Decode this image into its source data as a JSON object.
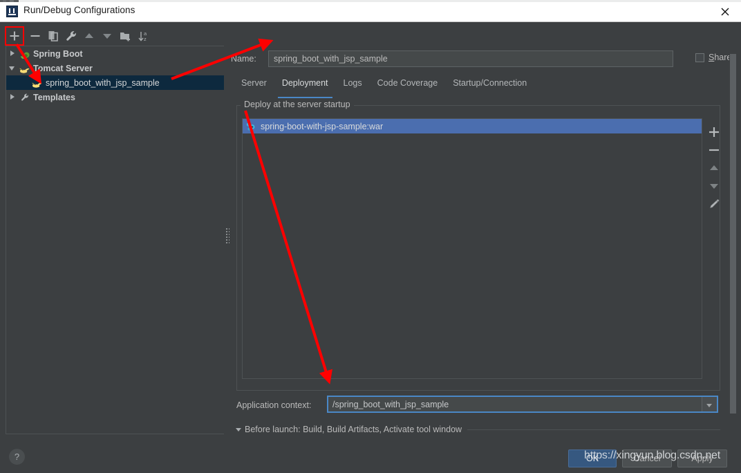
{
  "window": {
    "title": "Run/Debug Configurations",
    "app_icon": "intellij-idea-icon",
    "close_icon": "close-icon"
  },
  "left_panel": {
    "toolbar": [
      {
        "name": "add-configuration-button",
        "icon": "plus-icon",
        "label": "+",
        "highlighted": true
      },
      {
        "name": "remove-configuration-button",
        "icon": "minus-icon",
        "label": "−",
        "highlighted": false
      },
      {
        "name": "copy-configuration-button",
        "icon": "copy-icon",
        "label": "",
        "highlighted": false
      },
      {
        "name": "edit-templates-button",
        "icon": "wrench-icon",
        "label": "",
        "highlighted": false
      },
      {
        "name": "move-up-button",
        "icon": "arrow-up-icon",
        "label": "",
        "highlighted": false
      },
      {
        "name": "move-down-button",
        "icon": "arrow-down-icon",
        "label": "",
        "highlighted": false
      },
      {
        "name": "move-into-folder-button",
        "icon": "folder-add-icon",
        "label": "",
        "highlighted": false
      },
      {
        "name": "sort-configurations-button",
        "icon": "sort-az-icon",
        "label": "",
        "highlighted": false
      }
    ],
    "tree": [
      {
        "label": "Spring Boot",
        "icon": "spring-boot-icon",
        "expanded": false,
        "selected": false,
        "indent": 0
      },
      {
        "label": "Tomcat Server",
        "icon": "tomcat-icon",
        "expanded": true,
        "selected": false,
        "indent": 0
      },
      {
        "label": "spring_boot_with_jsp_sample",
        "icon": "tomcat-icon",
        "expanded": null,
        "selected": true,
        "indent": 1
      },
      {
        "label": "Templates",
        "icon": "wrench-icon",
        "expanded": false,
        "selected": false,
        "indent": 0
      }
    ]
  },
  "right_panel": {
    "name_label": "Name:",
    "name_value": "spring_boot_with_jsp_sample",
    "name_placeholder": "",
    "share": {
      "label": "Share",
      "mnemonic": "S",
      "rest": "hare",
      "checked": false
    },
    "tabs": [
      {
        "label": "Server",
        "active": false
      },
      {
        "label": "Deployment",
        "active": true
      },
      {
        "label": "Logs",
        "active": false
      },
      {
        "label": "Code Coverage",
        "active": false
      },
      {
        "label": "Startup/Connection",
        "active": false
      }
    ],
    "deploy_group": {
      "title": "Deploy at the server startup",
      "items": [
        {
          "label": "spring-boot-with-jsp-sample:war",
          "icon": "artifact-icon",
          "selected": true
        }
      ],
      "side_toolbar": [
        {
          "name": "add-artifact-button",
          "icon": "plus-icon"
        },
        {
          "name": "remove-artifact-button",
          "icon": "minus-icon"
        },
        {
          "name": "move-artifact-up-button",
          "icon": "arrow-up-icon"
        },
        {
          "name": "move-artifact-down-button",
          "icon": "arrow-down-icon"
        },
        {
          "name": "edit-artifact-button",
          "icon": "pencil-icon"
        }
      ]
    },
    "application_context": {
      "label": "Application context:",
      "value": "/spring_boot_with_jsp_sample",
      "placeholder": "",
      "dropdown_icon": "chevron-down-icon"
    },
    "before_launch": {
      "arrow_icon": "triangle-down-icon",
      "text": "Before launch: Build, Build Artifacts, Activate tool window"
    }
  },
  "bottom_bar": {
    "help_label": "?",
    "help_icon": "help-icon",
    "buttons": [
      {
        "name": "ok-button",
        "label": "OK",
        "primary": true
      },
      {
        "name": "cancel-button",
        "label": "Cancel",
        "primary": false
      },
      {
        "name": "apply-button",
        "label": "Apply",
        "primary": false
      }
    ]
  },
  "watermark": {
    "text": "https://xingyun.blog.csdn.net"
  },
  "annotation_color": "#ff0000",
  "colors": {
    "background": "#3c3f41",
    "tree_selection": "#0d293e",
    "list_selection": "#4b6eaf",
    "tab_underline": "#4a88c7",
    "focus_border": "#4a88c7",
    "primary_button": "#365880",
    "text": "#bbbbbb"
  }
}
